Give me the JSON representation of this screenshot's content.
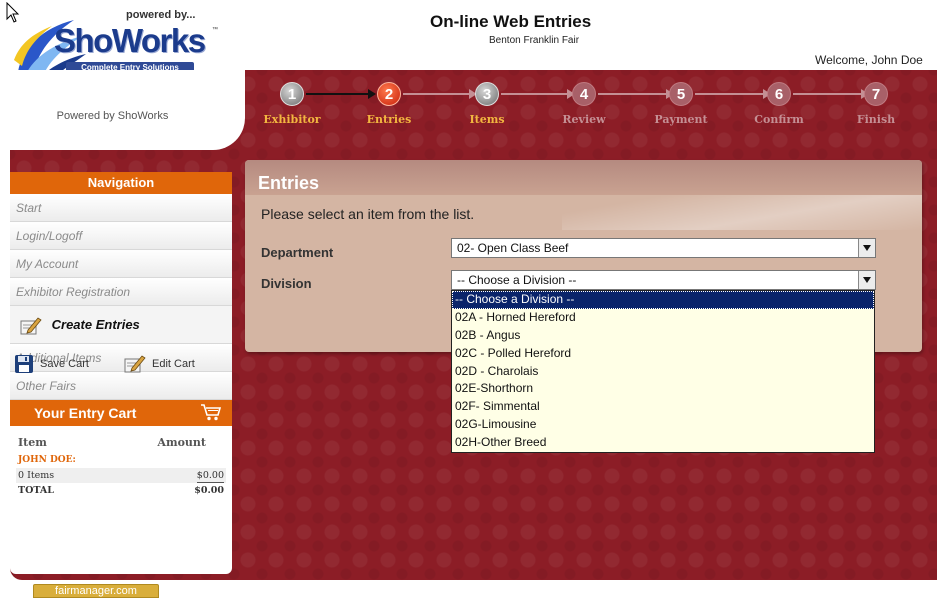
{
  "header": {
    "powered_by": "powered by...",
    "brand": "ShoWorks",
    "brand_tm": "™",
    "tagline": "Complete Entry Solutions",
    "powered_small": "Powered by ShoWorks",
    "site_title": "On-line Web Entries",
    "site_subtitle": "Benton Franklin Fair",
    "welcome": "Welcome, John Doe"
  },
  "steps": [
    {
      "number": "1",
      "label": "Exhibitor",
      "state": "done"
    },
    {
      "number": "2",
      "label": "Entries",
      "state": "current"
    },
    {
      "number": "3",
      "label": "Items",
      "state": "done"
    },
    {
      "number": "4",
      "label": "Review",
      "state": "pending"
    },
    {
      "number": "5",
      "label": "Payment",
      "state": "pending"
    },
    {
      "number": "6",
      "label": "Confirm",
      "state": "pending"
    },
    {
      "number": "7",
      "label": "Finish",
      "state": "pending"
    }
  ],
  "navigation": {
    "title": "Navigation",
    "items": [
      {
        "label": "Start"
      },
      {
        "label": "Login/Logoff"
      },
      {
        "label": "My Account"
      },
      {
        "label": "Exhibitor Registration"
      },
      {
        "label": "Create Entries",
        "active": true
      },
      {
        "label": "Additional Items"
      },
      {
        "label": "Other Fairs"
      }
    ]
  },
  "cart": {
    "title": "Your Entry Cart",
    "col_item": "Item",
    "col_amount": "Amount",
    "owner": "JOHN DOE:",
    "items_label": "0 Items",
    "items_amount": "$0.00",
    "total_label": "TOTAL",
    "total_amount": "$0.00",
    "save_label": "Save Cart",
    "edit_label": "Edit Cart"
  },
  "footer": {
    "badge": "fairmanager.com"
  },
  "entries": {
    "title": "Entries",
    "instruction": "Please select an item from the list.",
    "department_label": "Department",
    "department_value": "02- Open Class Beef",
    "division_label": "Division",
    "division_value": "-- Choose a Division --",
    "division_options": [
      {
        "label": "-- Choose a Division --",
        "selected": true
      },
      {
        "label": "02A - Horned Hereford"
      },
      {
        "label": "02B - Angus"
      },
      {
        "label": "02C - Polled Hereford"
      },
      {
        "label": "02D - Charolais"
      },
      {
        "label": "02E-Shorthorn"
      },
      {
        "label": "02F- Simmental"
      },
      {
        "label": "02G-Limousine"
      },
      {
        "label": "02H-Other Breed"
      }
    ]
  },
  "colors": {
    "background_red": "#8c1d26",
    "accent_orange": "#e0660a",
    "step_active": "#f2b640",
    "selected_option": "#0a246a"
  }
}
